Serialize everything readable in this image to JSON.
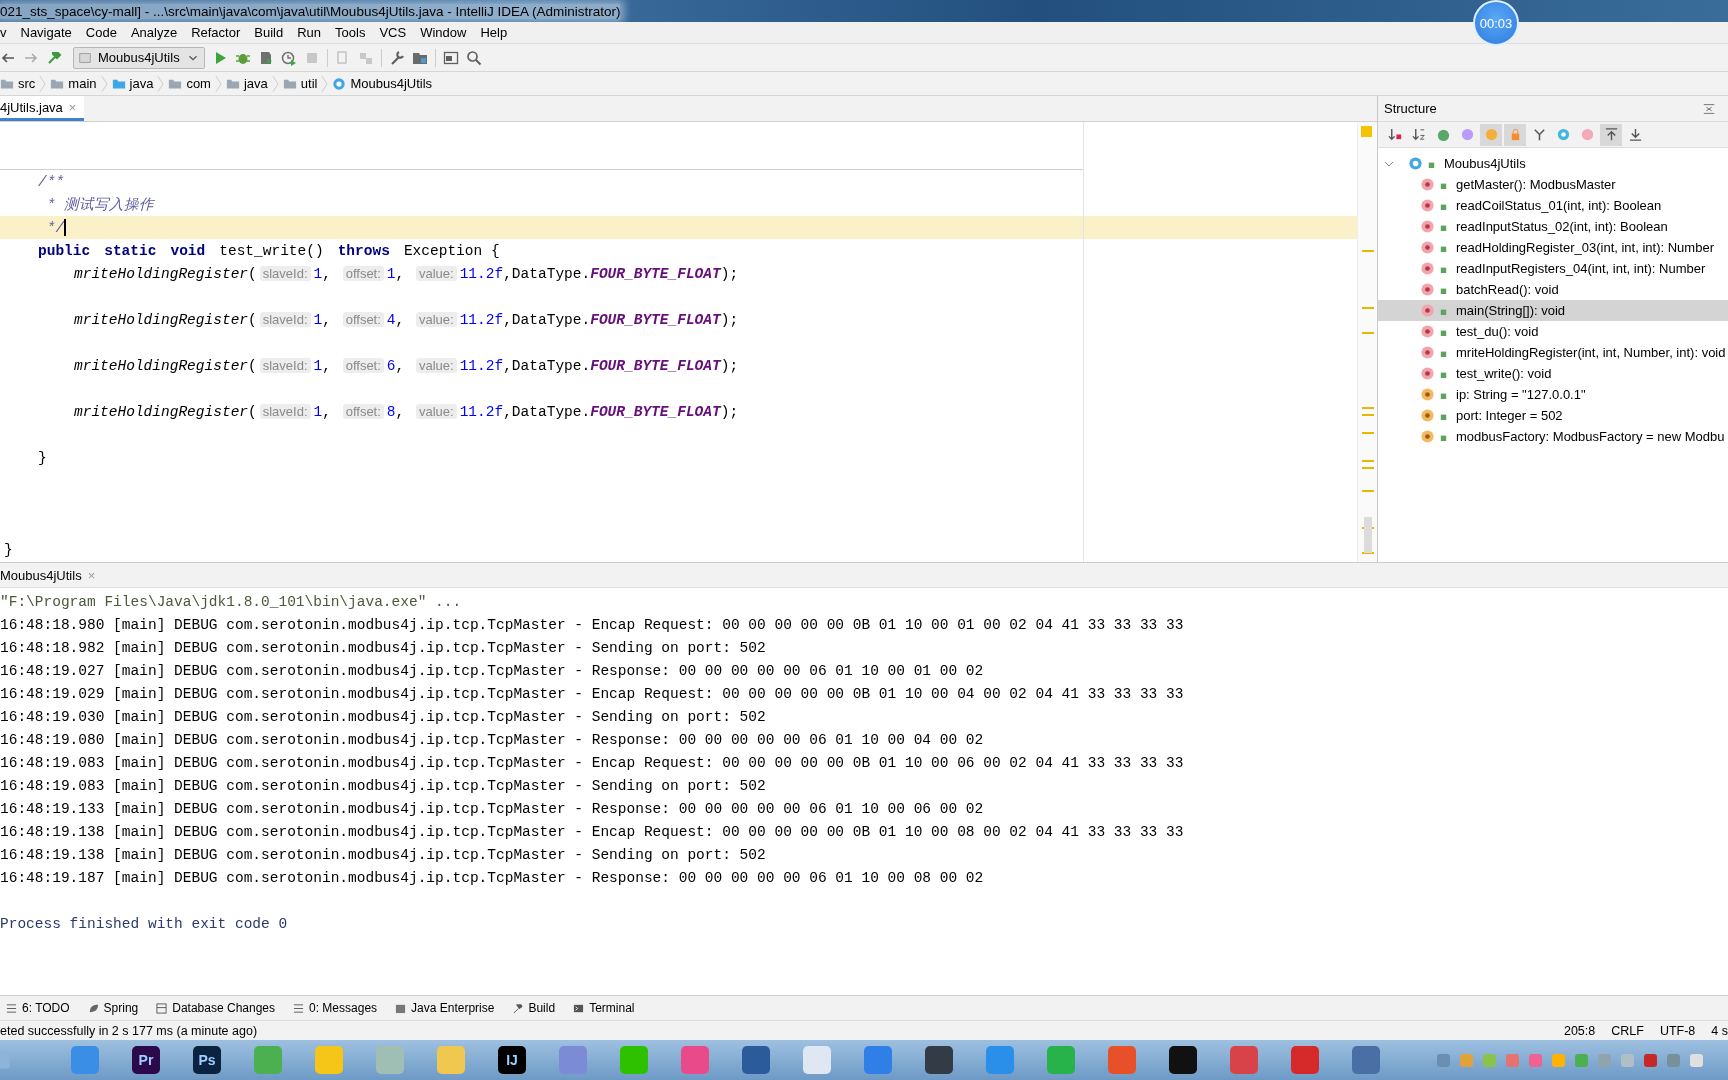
{
  "window": {
    "title": "021_sts_space\\cy-mall] - ...\\src\\main\\java\\com\\java\\util\\Moubus4jUtils.java - IntelliJ IDEA (Administrator)"
  },
  "timer": "00:03",
  "menu": [
    "v",
    "Navigate",
    "Code",
    "Analyze",
    "Refactor",
    "Build",
    "Run",
    "Tools",
    "VCS",
    "Window",
    "Help"
  ],
  "toolbar": {
    "run_config": "Moubus4jUtils"
  },
  "breadcrumbs": [
    {
      "label": "src",
      "kind": "folder"
    },
    {
      "label": "main",
      "kind": "folder"
    },
    {
      "label": "java",
      "kind": "source"
    },
    {
      "label": "com",
      "kind": "folder"
    },
    {
      "label": "java",
      "kind": "folder"
    },
    {
      "label": "util",
      "kind": "folder"
    },
    {
      "label": "Moubus4jUtils",
      "kind": "class"
    }
  ],
  "editor": {
    "tab": "4jUtils.java",
    "close": "×",
    "lines": [
      {
        "kind": "member",
        "current": false,
        "tokens": [
          {
            "kind": "comment",
            "text": "/**"
          }
        ]
      },
      {
        "kind": "member",
        "current": false,
        "tokens": [
          {
            "kind": "comment",
            "text": " * 测试写入操作"
          }
        ]
      },
      {
        "kind": "member",
        "current": true,
        "tokens": [
          {
            "kind": "comment",
            "text": " */"
          }
        ]
      },
      {
        "kind": "member",
        "current": false,
        "tokens": [
          {
            "kind": "keyword",
            "text": "public"
          },
          {
            "kind": "keyword",
            "text": "static"
          },
          {
            "kind": "keyword",
            "text": "void"
          },
          {
            "kind": "plain",
            "text": "test_write()"
          },
          {
            "kind": "keyword",
            "text": "throws"
          },
          {
            "kind": "plain",
            "text": "Exception {"
          }
        ]
      },
      {
        "kind": "body",
        "current": false,
        "tokens": [
          {
            "kind": "method",
            "text": "mriteHoldingRegister"
          },
          {
            "kind": "plain",
            "text": "("
          },
          {
            "kind": "hint",
            "text": "slaveId:"
          },
          {
            "kind": "number",
            "text": "1"
          },
          {
            "kind": "plain",
            "text": ", "
          },
          {
            "kind": "hint",
            "text": "offset:"
          },
          {
            "kind": "number",
            "text": "1"
          },
          {
            "kind": "plain",
            "text": ", "
          },
          {
            "kind": "hint",
            "text": "value:"
          },
          {
            "kind": "number",
            "text": "11.2f"
          },
          {
            "kind": "plain",
            "text": ",DataType."
          },
          {
            "kind": "constant",
            "text": "FOUR_BYTE_FLOAT"
          },
          {
            "kind": "plain",
            "text": ");"
          }
        ]
      },
      {
        "kind": "blank",
        "current": false
      },
      {
        "kind": "body",
        "current": false,
        "tokens": [
          {
            "kind": "method",
            "text": "mriteHoldingRegister"
          },
          {
            "kind": "plain",
            "text": "("
          },
          {
            "kind": "hint",
            "text": "slaveId:"
          },
          {
            "kind": "number",
            "text": "1"
          },
          {
            "kind": "plain",
            "text": ", "
          },
          {
            "kind": "hint",
            "text": "offset:"
          },
          {
            "kind": "number",
            "text": "4"
          },
          {
            "kind": "plain",
            "text": ", "
          },
          {
            "kind": "hint",
            "text": "value:"
          },
          {
            "kind": "number",
            "text": "11.2f"
          },
          {
            "kind": "plain",
            "text": ",DataType."
          },
          {
            "kind": "constant",
            "text": "FOUR_BYTE_FLOAT"
          },
          {
            "kind": "plain",
            "text": ");"
          }
        ]
      },
      {
        "kind": "blank",
        "current": false
      },
      {
        "kind": "body",
        "current": false,
        "tokens": [
          {
            "kind": "method",
            "text": "mriteHoldingRegister"
          },
          {
            "kind": "plain",
            "text": "("
          },
          {
            "kind": "hint",
            "text": "slaveId:"
          },
          {
            "kind": "number",
            "text": "1"
          },
          {
            "kind": "plain",
            "text": ", "
          },
          {
            "kind": "hint",
            "text": "offset:"
          },
          {
            "kind": "number",
            "text": "6"
          },
          {
            "kind": "plain",
            "text": ", "
          },
          {
            "kind": "hint",
            "text": "value:"
          },
          {
            "kind": "number",
            "text": "11.2f"
          },
          {
            "kind": "plain",
            "text": ",DataType."
          },
          {
            "kind": "constant",
            "text": "FOUR_BYTE_FLOAT"
          },
          {
            "kind": "plain",
            "text": ");"
          }
        ]
      },
      {
        "kind": "blank",
        "current": false
      },
      {
        "kind": "body",
        "current": false,
        "tokens": [
          {
            "kind": "method",
            "text": "mriteHoldingRegister"
          },
          {
            "kind": "plain",
            "text": "("
          },
          {
            "kind": "hint",
            "text": "slaveId:"
          },
          {
            "kind": "number",
            "text": "1"
          },
          {
            "kind": "plain",
            "text": ", "
          },
          {
            "kind": "hint",
            "text": "offset:"
          },
          {
            "kind": "number",
            "text": "8"
          },
          {
            "kind": "plain",
            "text": ", "
          },
          {
            "kind": "hint",
            "text": "value:"
          },
          {
            "kind": "number",
            "text": "11.2f"
          },
          {
            "kind": "plain",
            "text": ",DataType."
          },
          {
            "kind": "constant",
            "text": "FOUR_BYTE_FLOAT"
          },
          {
            "kind": "plain",
            "text": ");"
          }
        ]
      },
      {
        "kind": "blank",
        "current": false
      },
      {
        "kind": "member",
        "current": false,
        "tokens": [
          {
            "kind": "plain",
            "text": "}"
          }
        ]
      },
      {
        "kind": "blank",
        "current": false
      },
      {
        "kind": "blank",
        "current": false
      },
      {
        "kind": "blank",
        "current": false
      },
      {
        "kind": "class",
        "current": false,
        "tokens": [
          {
            "kind": "plain",
            "text": "}"
          }
        ]
      }
    ]
  },
  "structure": {
    "title": "Structure",
    "tools": [
      {
        "kind": "sort-visibility",
        "selected": false
      },
      {
        "kind": "sort-alpha",
        "selected": false
      },
      {
        "kind": "inherited",
        "selected": false
      },
      {
        "kind": "properties",
        "selected": false
      },
      {
        "kind": "fields",
        "selected": true
      },
      {
        "kind": "non-public",
        "selected": true
      },
      {
        "kind": "anonymous",
        "selected": false
      },
      {
        "kind": "lambdas",
        "selected": false
      },
      {
        "kind": "lambda",
        "selected": false
      },
      {
        "kind": "autoscroll-to",
        "selected": true
      },
      {
        "kind": "autoscroll-from",
        "selected": false
      }
    ],
    "root": {
      "label": "Moubus4jUtils",
      "expanded": true,
      "children": [
        {
          "label": "getMaster(): ModbusMaster",
          "kind": "method",
          "selected": false
        },
        {
          "label": "readCoilStatus_01(int, int): Boolean",
          "kind": "method",
          "selected": false
        },
        {
          "label": "readInputStatus_02(int, int): Boolean",
          "kind": "method",
          "selected": false
        },
        {
          "label": "readHoldingRegister_03(int, int, int): Number",
          "kind": "method",
          "selected": false
        },
        {
          "label": "readInputRegisters_04(int, int, int): Number",
          "kind": "method",
          "selected": false
        },
        {
          "label": "batchRead(): void",
          "kind": "method",
          "selected": false
        },
        {
          "label": "main(String[]): void",
          "kind": "method",
          "selected": true
        },
        {
          "label": "test_du(): void",
          "kind": "method",
          "selected": false
        },
        {
          "label": "mriteHoldingRegister(int, int, Number, int): void",
          "kind": "method",
          "selected": false
        },
        {
          "label": "test_write(): void",
          "kind": "method",
          "selected": false
        },
        {
          "label": "ip: String = \"127.0.0.1\"",
          "kind": "field",
          "selected": false
        },
        {
          "label": "port: Integer = 502",
          "kind": "field",
          "selected": false
        },
        {
          "label": "modbusFactory: ModbusFactory = new Modbu",
          "kind": "field",
          "selected": false
        }
      ]
    }
  },
  "console": {
    "tab": "Moubus4jUtils",
    "close": "×",
    "lines": [
      {
        "kind": "command",
        "text": "\"F:\\Program Files\\Java\\jdk1.8.0_101\\bin\\java.exe\" ..."
      },
      {
        "kind": "log",
        "text": "16:48:18.980 [main] DEBUG com.serotonin.modbus4j.ip.tcp.TcpMaster - Encap Request: 00 00 00 00 00 0B 01 10 00 01 00 02 04 41 33 33 33 33"
      },
      {
        "kind": "log",
        "text": "16:48:18.982 [main] DEBUG com.serotonin.modbus4j.ip.tcp.TcpMaster - Sending on port: 502"
      },
      {
        "kind": "log",
        "text": "16:48:19.027 [main] DEBUG com.serotonin.modbus4j.ip.tcp.TcpMaster - Response: 00 00 00 00 00 06 01 10 00 01 00 02"
      },
      {
        "kind": "log",
        "text": "16:48:19.029 [main] DEBUG com.serotonin.modbus4j.ip.tcp.TcpMaster - Encap Request: 00 00 00 00 00 0B 01 10 00 04 00 02 04 41 33 33 33 33"
      },
      {
        "kind": "log",
        "text": "16:48:19.030 [main] DEBUG com.serotonin.modbus4j.ip.tcp.TcpMaster - Sending on port: 502"
      },
      {
        "kind": "log",
        "text": "16:48:19.080 [main] DEBUG com.serotonin.modbus4j.ip.tcp.TcpMaster - Response: 00 00 00 00 00 06 01 10 00 04 00 02"
      },
      {
        "kind": "log",
        "text": "16:48:19.083 [main] DEBUG com.serotonin.modbus4j.ip.tcp.TcpMaster - Encap Request: 00 00 00 00 00 0B 01 10 00 06 00 02 04 41 33 33 33 33"
      },
      {
        "kind": "log",
        "text": "16:48:19.083 [main] DEBUG com.serotonin.modbus4j.ip.tcp.TcpMaster - Sending on port: 502"
      },
      {
        "kind": "log",
        "text": "16:48:19.133 [main] DEBUG com.serotonin.modbus4j.ip.tcp.TcpMaster - Response: 00 00 00 00 00 06 01 10 00 06 00 02"
      },
      {
        "kind": "log",
        "text": "16:48:19.138 [main] DEBUG com.serotonin.modbus4j.ip.tcp.TcpMaster - Encap Request: 00 00 00 00 00 0B 01 10 00 08 00 02 04 41 33 33 33 33"
      },
      {
        "kind": "log",
        "text": "16:48:19.138 [main] DEBUG com.serotonin.modbus4j.ip.tcp.TcpMaster - Sending on port: 502"
      },
      {
        "kind": "log",
        "text": "16:48:19.187 [main] DEBUG com.serotonin.modbus4j.ip.tcp.TcpMaster - Response: 00 00 00 00 00 06 01 10 00 08 00 02"
      },
      {
        "kind": "blank"
      },
      {
        "kind": "exit",
        "text": "Process finished with exit code 0"
      }
    ]
  },
  "tool_windows": [
    {
      "label": "6: TODO",
      "kind": "list"
    },
    {
      "label": "Spring",
      "kind": "leaf"
    },
    {
      "label": "Database Changes",
      "kind": "db"
    },
    {
      "label": "0: Messages",
      "kind": "list"
    },
    {
      "label": "Java Enterprise",
      "kind": "enterprise"
    },
    {
      "label": "Build",
      "kind": "hammer"
    },
    {
      "label": "Terminal",
      "kind": "terminal"
    }
  ],
  "status_bar": {
    "message": "eted successfully in 2 s 177 ms (a minute ago)",
    "items": [
      "205:8",
      "CRLF",
      "UTF-8",
      "4 s"
    ]
  },
  "taskbar": [
    {
      "color": "#3a8ee6"
    },
    {
      "color": "#2a0a4a",
      "label": "Pr"
    },
    {
      "color": "#0b2340",
      "label": "Ps"
    },
    {
      "color": "#4caf50"
    },
    {
      "color": "#f5c518"
    },
    {
      "color": "#9fbfb4"
    },
    {
      "color": "#f0c850"
    },
    {
      "color": "#000000",
      "label": "IJ"
    },
    {
      "color": "#7b8bd6"
    },
    {
      "color": "#2dc100"
    },
    {
      "color": "#e94b8a"
    },
    {
      "color": "#2b5b9a"
    },
    {
      "color": "#dfe8f2"
    },
    {
      "color": "#2f7fe6"
    },
    {
      "color": "#333c46"
    },
    {
      "color": "#2a8fe8"
    },
    {
      "color": "#27b34a"
    },
    {
      "color": "#e8502a"
    },
    {
      "color": "#111111"
    },
    {
      "color": "#d8434a"
    },
    {
      "color": "#d62a2a"
    },
    {
      "color": "#4a6fa5"
    }
  ]
}
